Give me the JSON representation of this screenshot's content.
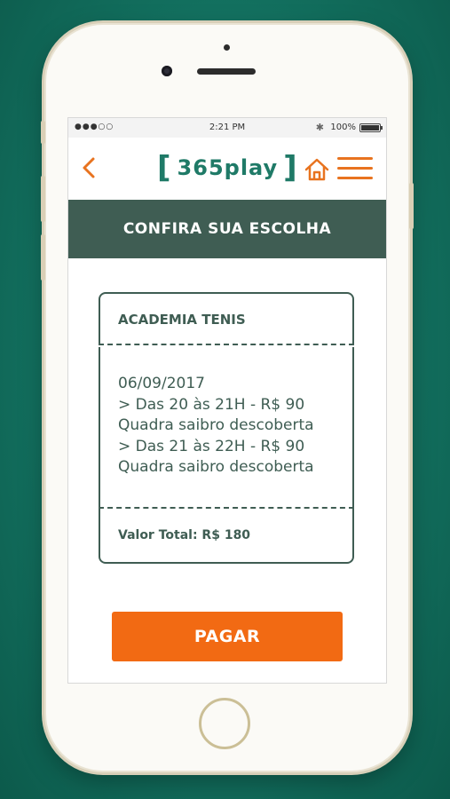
{
  "status_bar": {
    "carrier": "●●●○○",
    "time": "2:21 PM",
    "battery": "100%"
  },
  "header": {
    "logo_bracket_left": "[",
    "logo_text": "365play",
    "logo_bracket_right": "]",
    "back_icon": "chevron-left-icon",
    "home_icon": "home-icon",
    "menu_icon": "hamburger-menu-icon"
  },
  "banner": {
    "title": "CONFIRA SUA ESCOLHA"
  },
  "summary": {
    "venue": "ACADEMIA TENIS",
    "date": "06/09/2017",
    "lines": [
      "> Das 20 às 21H - R$ 90",
      "Quadra saibro descoberta",
      "> Das 21 às 22H - R$ 90",
      "Quadra saibro descoberta"
    ],
    "total": "Valor Total: R$ 180"
  },
  "actions": {
    "pay_label": "PAGAR"
  },
  "colors": {
    "accent": "#f26a13",
    "primary_dark": "#3f5d53",
    "brand": "#1f7a67",
    "background": "#137160"
  }
}
